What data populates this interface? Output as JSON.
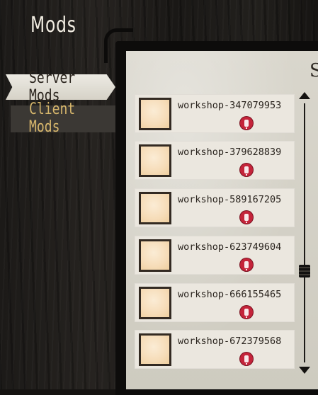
{
  "header": {
    "title": "Mods"
  },
  "tabs": [
    {
      "label": "Server Mods",
      "selected": true
    },
    {
      "label": "Client Mods",
      "selected": false
    }
  ],
  "panel": {
    "title_partial": "Se"
  },
  "mods": [
    {
      "name": "workshop-347079953",
      "status_icon": "warning-icon"
    },
    {
      "name": "workshop-379628839",
      "status_icon": "warning-icon"
    },
    {
      "name": "workshop-589167205",
      "status_icon": "warning-icon"
    },
    {
      "name": "workshop-623749604",
      "status_icon": "warning-icon"
    },
    {
      "name": "workshop-666155465",
      "status_icon": "warning-icon"
    },
    {
      "name": "workshop-672379568",
      "status_icon": "warning-icon"
    }
  ],
  "colors": {
    "accent_gold": "#d6b66c",
    "warning_red": "#c4243a",
    "paper": "#ebe7df"
  }
}
